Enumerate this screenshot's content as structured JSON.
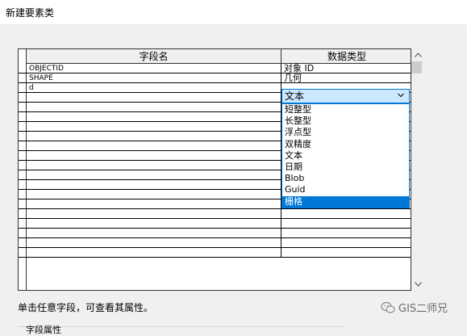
{
  "window": {
    "title": "新建要素类"
  },
  "grid": {
    "headers": {
      "field_name": "字段名",
      "data_type": "数据类型"
    },
    "rows": [
      {
        "name": "OBJECTID",
        "type": "对象 ID"
      },
      {
        "name": "SHAPE",
        "type": "几何"
      },
      {
        "name": "d",
        "type": ""
      }
    ],
    "empty_row_count": 17
  },
  "dropdown": {
    "selected_value": "文本",
    "options": [
      "短整型",
      "长整型",
      "浮点型",
      "双精度",
      "文本",
      "日期",
      "Blob",
      "Guid",
      "栅格"
    ],
    "highlighted": "栅格"
  },
  "hint": "单击任意字段，可查看其属性。",
  "field_properties_label": "字段属性",
  "watermark": {
    "text": "GIS二师兄",
    "icon": "wechat-icon"
  },
  "colors": {
    "accent": "#0078d7",
    "selection_bg": "#cce8ff"
  }
}
